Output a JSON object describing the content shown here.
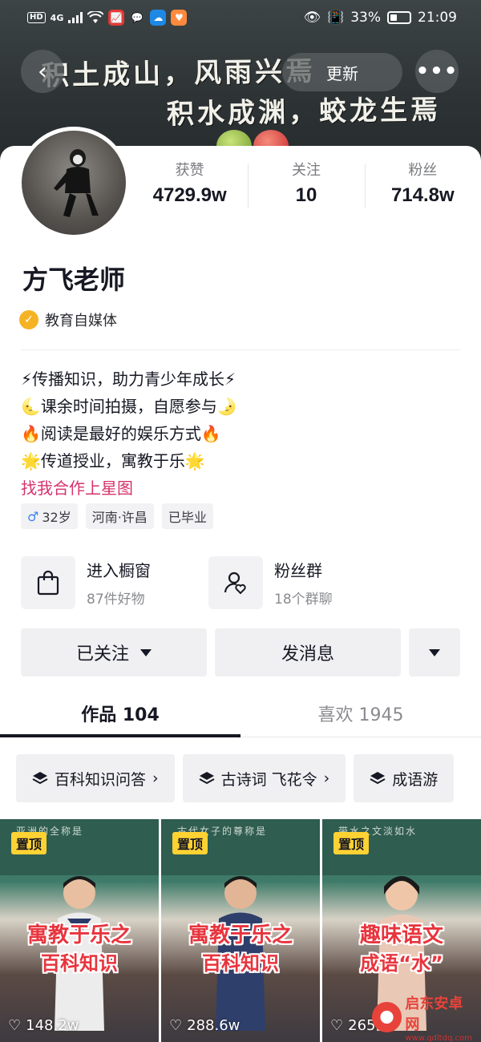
{
  "status_bar": {
    "hd": "HD",
    "network": "4G",
    "battery_pct": "33%",
    "time": "21:09"
  },
  "banner": {
    "line1": "积土成山，风雨兴焉",
    "line2": "积水成渊，蛟龙生焉"
  },
  "nav": {
    "back_icon": "back-chevron-icon",
    "update_label": "更新",
    "more_icon": "more-dots-icon"
  },
  "profile": {
    "name": "方飞老师",
    "verified_label": "教育自媒体",
    "stats": [
      {
        "label": "获赞",
        "value": "4729.9w"
      },
      {
        "label": "关注",
        "value": "10"
      },
      {
        "label": "粉丝",
        "value": "714.8w"
      }
    ],
    "bio": [
      "⚡传播知识，助力青少年成长⚡",
      "🌜课余时间拍摄，自愿参与🌛",
      "🔥阅读是最好的娱乐方式🔥",
      "🌟传道授业，寓教于乐🌟"
    ],
    "bio_link": "找我合作上星图",
    "tags": [
      {
        "icon": "♂",
        "text": "32岁"
      },
      {
        "icon": "",
        "text": "河南·许昌"
      },
      {
        "icon": "",
        "text": "已毕业"
      }
    ]
  },
  "services": [
    {
      "title": "进入橱窗",
      "subtitle": "87件好物",
      "icon": "shopping-bag-icon"
    },
    {
      "title": "粉丝群",
      "subtitle": "18个群聊",
      "icon": "fan-group-icon"
    }
  ],
  "actions": {
    "follow_label": "已关注",
    "message_label": "发消息"
  },
  "tabs": [
    {
      "label": "作品 104",
      "active": true
    },
    {
      "label": "喜欢 1945",
      "active": false
    }
  ],
  "collections": [
    "百科知识问答",
    "古诗词 飞花令",
    "成语游"
  ],
  "videos": [
    {
      "pinned": "置顶",
      "board_text": "亚洲的全称是",
      "caption1": "寓教于乐之",
      "caption2": "百科知识",
      "likes": "148.2w"
    },
    {
      "pinned": "置顶",
      "board_text": "古代女子的尊称是",
      "caption1": "寓教于乐之",
      "caption2": "百科知识",
      "likes": "288.6w"
    },
    {
      "pinned": "置顶",
      "board_text": "带水之文淡如水",
      "caption1": "趣味语文",
      "caption2": "成语“水”",
      "likes": "265"
    }
  ],
  "watermark": {
    "title": "启东安卓网",
    "url": "www.qdltdq.com"
  }
}
